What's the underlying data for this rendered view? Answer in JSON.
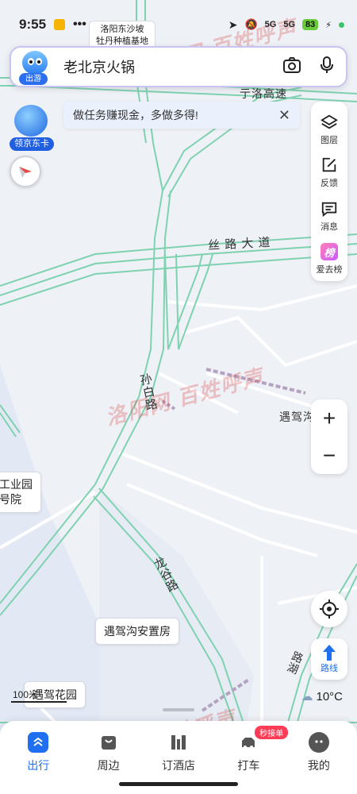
{
  "status_bar": {
    "time": "9:55",
    "signal_1": "5G",
    "signal_2": "5G",
    "battery": "83"
  },
  "search": {
    "mascot_tag": "出游",
    "placeholder": "老北京火锅"
  },
  "task_banner": {
    "text": "做任务赚现金，多做多得!"
  },
  "jd_card": {
    "label": "领京东卡"
  },
  "right_tools": [
    {
      "label": "图层",
      "icon": "layers-icon"
    },
    {
      "label": "反馈",
      "icon": "feedback-icon"
    },
    {
      "label": "消息",
      "icon": "message-icon"
    },
    {
      "label": "爱去榜",
      "icon": "rank-icon",
      "glyph": "榜"
    }
  ],
  "zoom": {
    "in": "+",
    "out": "−"
  },
  "route": {
    "label": "路线"
  },
  "weather": {
    "temp": "10°C"
  },
  "map": {
    "roads": {
      "g1": "亍洛高速",
      "silk_road": "丝 路 大 道",
      "sunbai": "孙白路",
      "longgu": "龙谷路",
      "right_road": "路湖"
    },
    "places": {
      "top_poi_line1": "洛阳东沙坡",
      "top_poi_line2": "牡丹种植基地",
      "yujia_right": "遇驾沟",
      "industrial_line1": "工业园",
      "industrial_line2": "号院",
      "resettlement": "遇驾沟安置房",
      "garden": "遇驾花园"
    },
    "scale": "100米",
    "watermark_1": "洛阳网 百姓呼声",
    "watermark_2": "洛阳网 百姓呼声",
    "watermark_3": "洛阳网 百姓呼声",
    "watermark_4": "洛阳网 百姓呼声"
  },
  "bottom_nav": {
    "items": [
      {
        "label": "出行",
        "active": true
      },
      {
        "label": "周边",
        "active": false
      },
      {
        "label": "订酒店",
        "active": false
      },
      {
        "label": "打车",
        "active": false,
        "badge": "秒接单"
      },
      {
        "label": "我的",
        "active": false
      }
    ]
  },
  "colors": {
    "accent": "#1f6ff0",
    "road": "#7fd2b0",
    "map_bg": "#eef1f6"
  }
}
